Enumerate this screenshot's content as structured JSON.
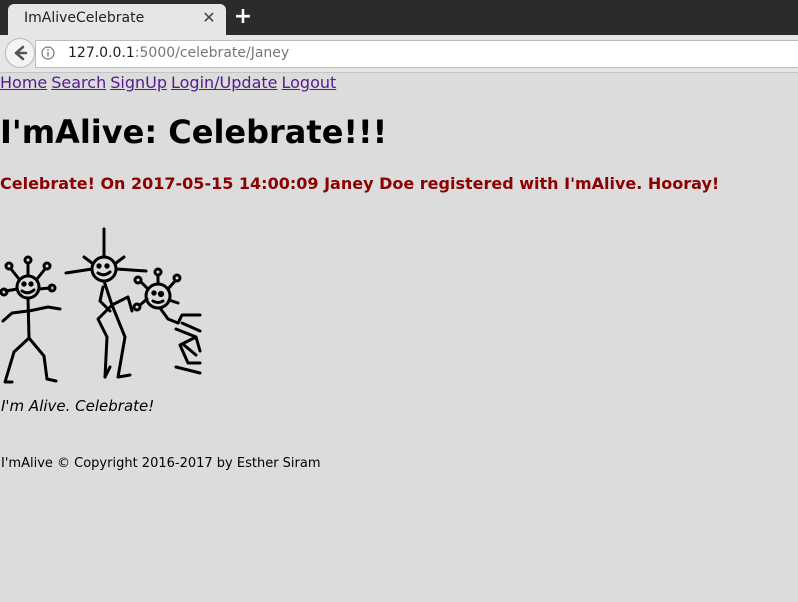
{
  "browser": {
    "tab_title": "ImAliveCelebrate",
    "tab_close_icon": "close-icon",
    "new_tab_icon": "plus-icon",
    "url_host": "127.0.0.1",
    "url_path": ":5000/celebrate/Janey"
  },
  "nav": {
    "items": [
      {
        "label": "Home"
      },
      {
        "label": "Search"
      },
      {
        "label": "SignUp"
      },
      {
        "label": "Login/Update"
      },
      {
        "label": "Logout"
      }
    ],
    "link_color": "#551a8b"
  },
  "main": {
    "title": "I'mAlive: Celebrate!!!",
    "message": "Celebrate! On 2017-05-15 14:00:09 Janey Doe registered with I'mAlive. Hooray!",
    "message_color": "#8b0000",
    "image_name": "dancing-stick-figures",
    "caption": "I'm Alive. Celebrate!"
  },
  "footer": {
    "text": "I'mAlive © Copyright 2016-2017 by Esther Siram"
  },
  "colors": {
    "page_background": "#dcdcdc",
    "tabstrip": "#2b2b2b"
  }
}
